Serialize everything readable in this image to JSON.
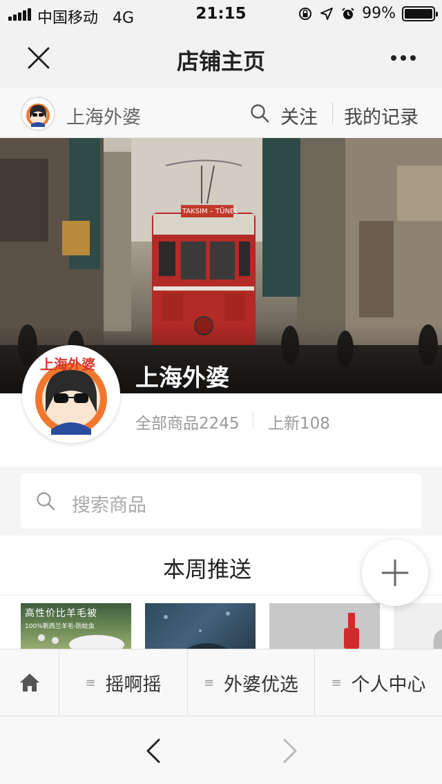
{
  "status_bar": {
    "carrier": "中国移动",
    "network": "4G",
    "time": "21:15",
    "battery_percent": "99%",
    "battery_level": 0.99
  },
  "nav": {
    "title": "店铺主页",
    "close_icon": "close-icon",
    "more_icon": "more-icon"
  },
  "shop_header": {
    "name": "上海外婆",
    "follow_label": "关注",
    "records_label": "我的记录"
  },
  "banner": {
    "sign_text": "TAKSIM – TÜNEL"
  },
  "profile": {
    "shop_title": "上海外婆",
    "avatar_label": "上海外婆",
    "all_items": "全部商品2245",
    "new_items": "上新108"
  },
  "search": {
    "placeholder": "搜索商品"
  },
  "weekly": {
    "title": "本周推送",
    "thumb1_title": "高性价比羊毛被",
    "thumb1_subtitle": "100%新西兰羊毛·防蛀虫"
  },
  "tabbar": {
    "items": [
      {
        "label": "摇啊摇"
      },
      {
        "label": "外婆优选"
      },
      {
        "label": "个人中心"
      }
    ]
  },
  "colors": {
    "accent_red": "#c0392b",
    "avatar_orange": "#f0772d",
    "text_gray": "#999999"
  }
}
